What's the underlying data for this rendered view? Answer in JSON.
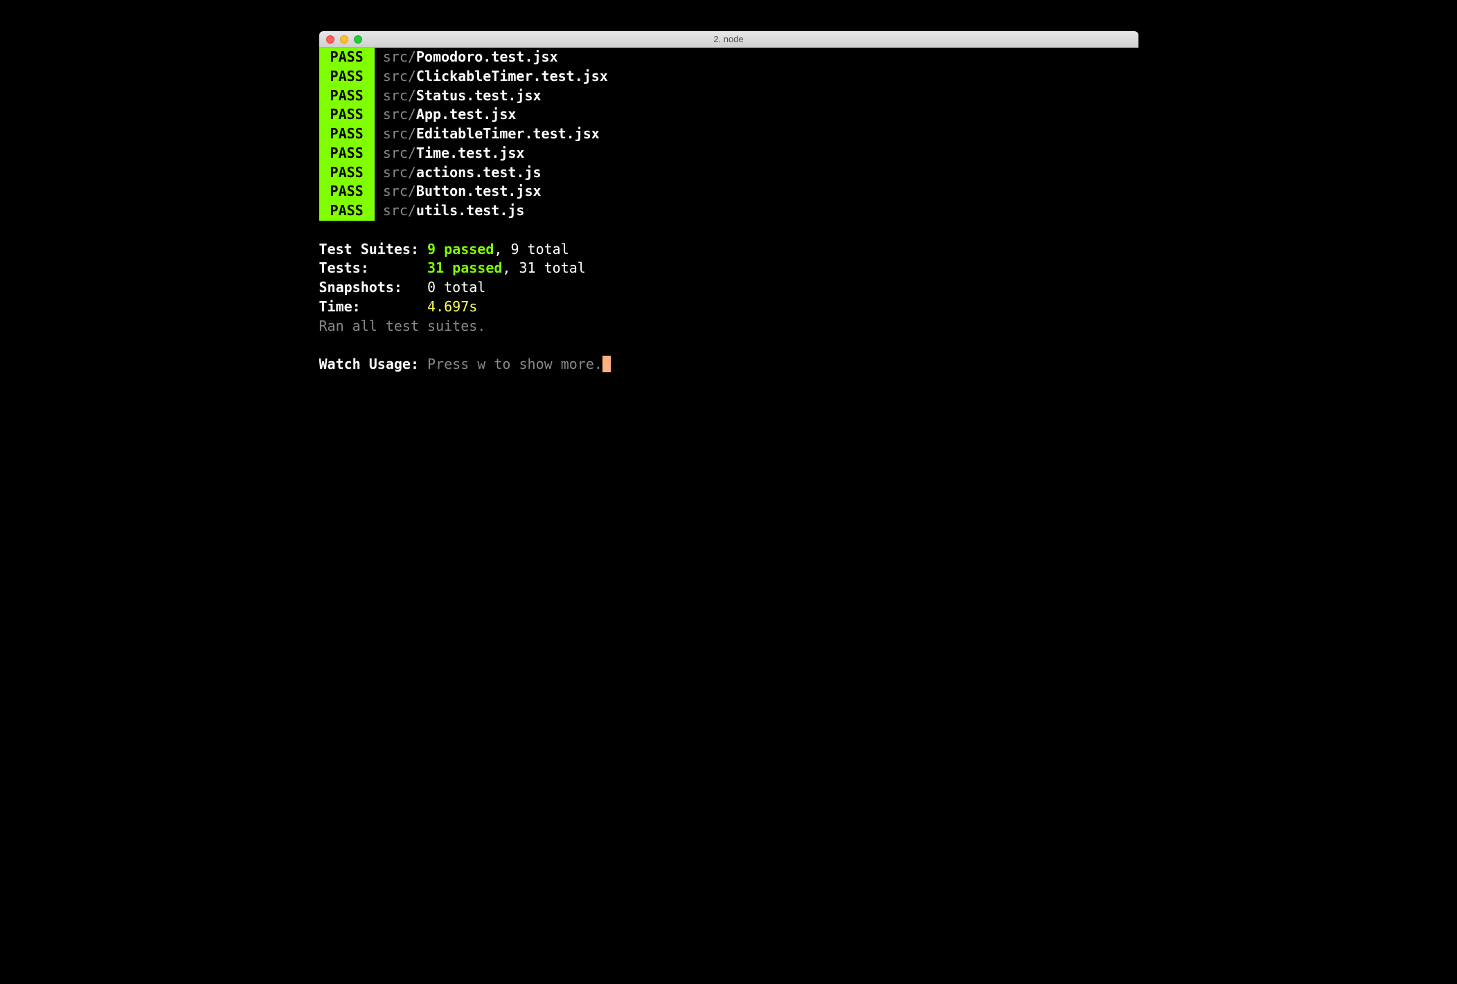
{
  "window": {
    "title": "2. node"
  },
  "tests": [
    {
      "status": "PASS",
      "dir": "src/",
      "file": "Pomodoro.test.jsx"
    },
    {
      "status": "PASS",
      "dir": "src/",
      "file": "ClickableTimer.test.jsx"
    },
    {
      "status": "PASS",
      "dir": "src/",
      "file": "Status.test.jsx"
    },
    {
      "status": "PASS",
      "dir": "src/",
      "file": "App.test.jsx"
    },
    {
      "status": "PASS",
      "dir": "src/",
      "file": "EditableTimer.test.jsx"
    },
    {
      "status": "PASS",
      "dir": "src/",
      "file": "Time.test.jsx"
    },
    {
      "status": "PASS",
      "dir": "src/",
      "file": "actions.test.js"
    },
    {
      "status": "PASS",
      "dir": "src/",
      "file": "Button.test.jsx"
    },
    {
      "status": "PASS",
      "dir": "src/",
      "file": "utils.test.js"
    }
  ],
  "summary": {
    "suites_label": "Test Suites: ",
    "suites_passed": "9 passed",
    "suites_total": ", 9 total",
    "tests_label": "Tests:       ",
    "tests_passed": "31 passed",
    "tests_total": ", 31 total",
    "snapshots_label": "Snapshots:   ",
    "snapshots_value": "0 total",
    "time_label": "Time:        ",
    "time_value": "4.697s",
    "ran_message": "Ran all test suites."
  },
  "watch": {
    "label": "Watch Usage:",
    "hint": " Press w to show more."
  }
}
